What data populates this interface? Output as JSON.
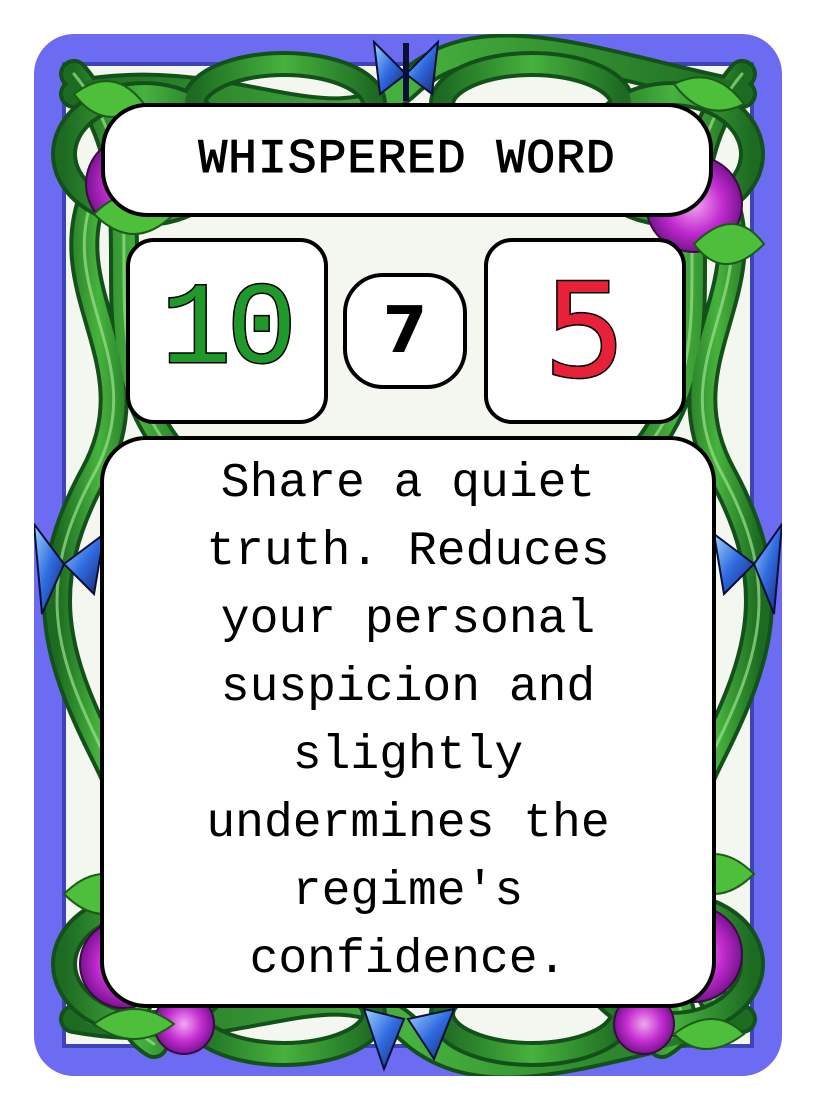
{
  "card": {
    "title": "WHISPERED WORD",
    "stats": {
      "left_value": "10",
      "middle_value": "7",
      "right_value": "5"
    },
    "description": "Share a quiet truth. Reduces your personal suspicion and slightly undermines the regime's confidence."
  },
  "colors": {
    "frame_background": "#6b6cf2",
    "left_value_color": "#1f9a2a",
    "right_value_color": "#e8213b",
    "panel_fill": "#ffffff",
    "panel_border": "#000000",
    "vine_green": "#2f8f2c",
    "flower_magenta": "#c22bd0",
    "butterfly_blue": "#2f6be0"
  },
  "decorations": {
    "frame": "woven-vine-frame",
    "corner_flowers": "magenta-flower-icon",
    "butterflies": "blue-butterfly-icon"
  }
}
